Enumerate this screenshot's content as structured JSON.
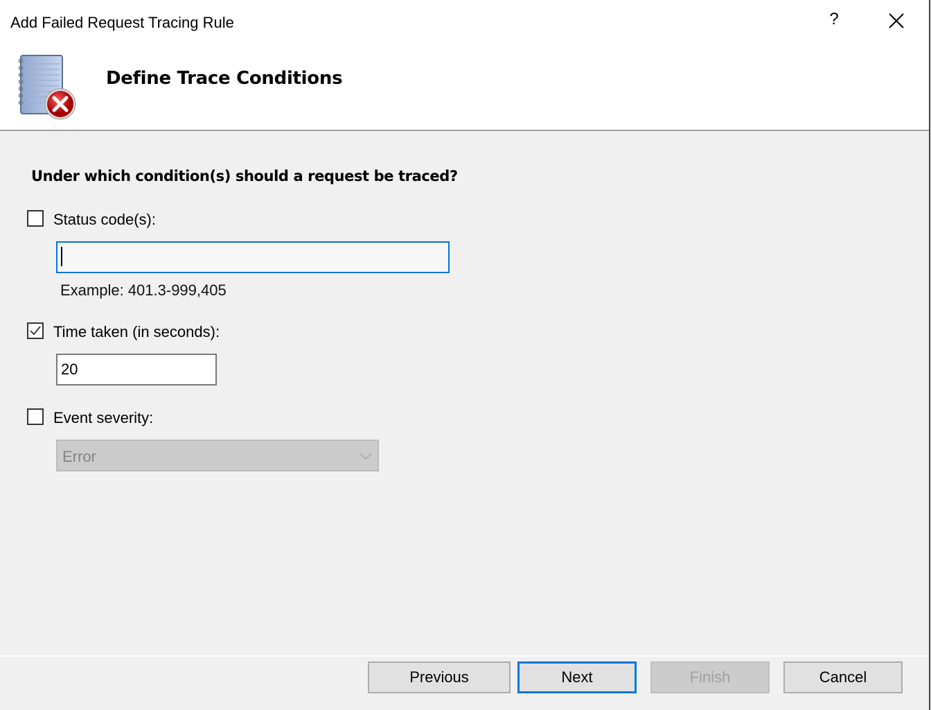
{
  "window": {
    "title": "Add Failed Request Tracing Rule",
    "help_label": "?",
    "accent_color": "#0078d7"
  },
  "header": {
    "title": "Define Trace Conditions",
    "icon": "notebook-error-icon"
  },
  "form": {
    "question": "Under which condition(s) should a request be traced?",
    "status_codes": {
      "label": "Status code(s):",
      "checked": false,
      "value": "",
      "example": "Example: 401.3-999,405"
    },
    "time_taken": {
      "label": "Time taken (in seconds):",
      "checked": true,
      "value": "20"
    },
    "event_severity": {
      "label": "Event severity:",
      "checked": false,
      "selected": "Error",
      "disabled": true
    }
  },
  "buttons": {
    "previous": "Previous",
    "next": "Next",
    "finish": "Finish",
    "cancel": "Cancel"
  }
}
